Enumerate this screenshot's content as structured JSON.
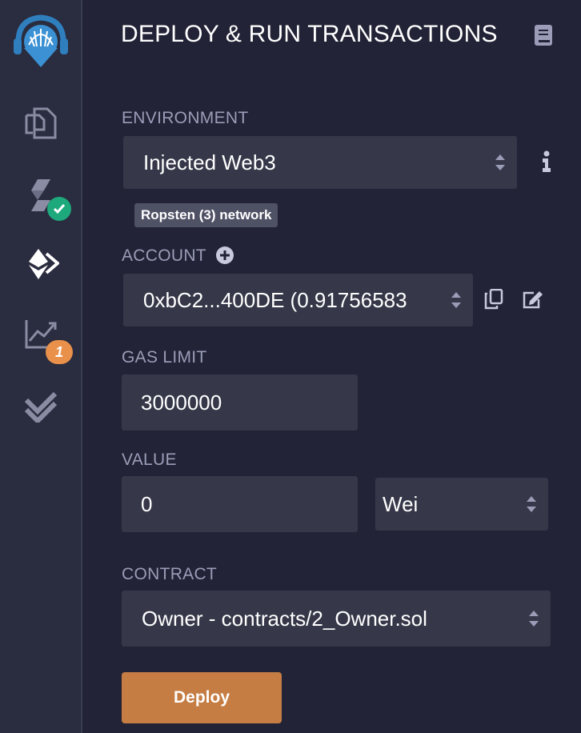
{
  "sidebar": {
    "icons": [
      {
        "name": "remix-logo-icon"
      },
      {
        "name": "file-explorer-icon"
      },
      {
        "name": "solidity-compiler-icon"
      },
      {
        "name": "deploy-run-icon"
      },
      {
        "name": "analysis-icon"
      },
      {
        "name": "test-icon"
      }
    ],
    "analysis_badge": "1",
    "colors": {
      "check_badge": "#1ea97c",
      "count_badge": "#e9914a"
    }
  },
  "panel": {
    "title": "DEPLOY & RUN TRANSACTIONS",
    "environment": {
      "label": "ENVIRONMENT",
      "value": "Injected Web3",
      "network": "Ropsten (3) network"
    },
    "account": {
      "label": "ACCOUNT",
      "value": "0xbC2...400DE (0.91756583"
    },
    "gas_limit": {
      "label": "GAS LIMIT",
      "value": "3000000"
    },
    "value": {
      "label": "VALUE",
      "amount": "0",
      "unit": "Wei"
    },
    "contract": {
      "label": "CONTRACT",
      "value": "Owner - contracts/2_Owner.sol"
    },
    "deploy_label": "Deploy",
    "colors": {
      "accent": "#c57d44",
      "panel_bg": "#222336",
      "field_bg": "#363849"
    }
  }
}
